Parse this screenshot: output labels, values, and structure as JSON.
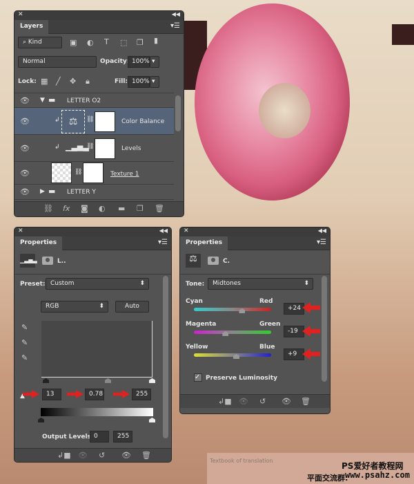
{
  "layers": {
    "tab": "Layers",
    "filter": "Kind",
    "blend_mode": "Normal",
    "opacity_label": "Opacity:",
    "opacity": "100%",
    "lock_label": "Lock:",
    "fill_label": "Fill:",
    "fill": "100%",
    "items": [
      {
        "name": "LETTER O2"
      },
      {
        "name": "Color Balance"
      },
      {
        "name": "Levels"
      },
      {
        "name": "Texture 1"
      },
      {
        "name": "LETTER Y"
      }
    ]
  },
  "levels": {
    "tab": "Properties",
    "title": "L..",
    "preset_label": "Preset:",
    "preset": "Custom",
    "channel": "RGB",
    "auto": "Auto",
    "input_black": "13",
    "input_mid": "0.78",
    "input_white": "255",
    "output_label": "Output Levels:",
    "output_black": "0",
    "output_white": "255"
  },
  "color_balance": {
    "tab": "Properties",
    "title": "C.",
    "tone_label": "Tone:",
    "tone": "Midtones",
    "sliders": [
      {
        "left": "Cyan",
        "right": "Red",
        "value": "+24",
        "gradient": [
          "#3cc",
          "#c22"
        ]
      },
      {
        "left": "Magenta",
        "right": "Green",
        "value": "-19",
        "gradient": [
          "#c2c",
          "#3c3"
        ]
      },
      {
        "left": "Yellow",
        "right": "Blue",
        "value": "+9",
        "gradient": [
          "#dd3",
          "#22c"
        ]
      }
    ],
    "preserve_luminosity": "Preserve Luminosity",
    "preserve_checked": true
  },
  "caption": "Textbook of translation",
  "watermark": {
    "line1": "PS爱好者教程网",
    "line2": "www.psahz.com",
    "line3": "平面交流群:"
  }
}
